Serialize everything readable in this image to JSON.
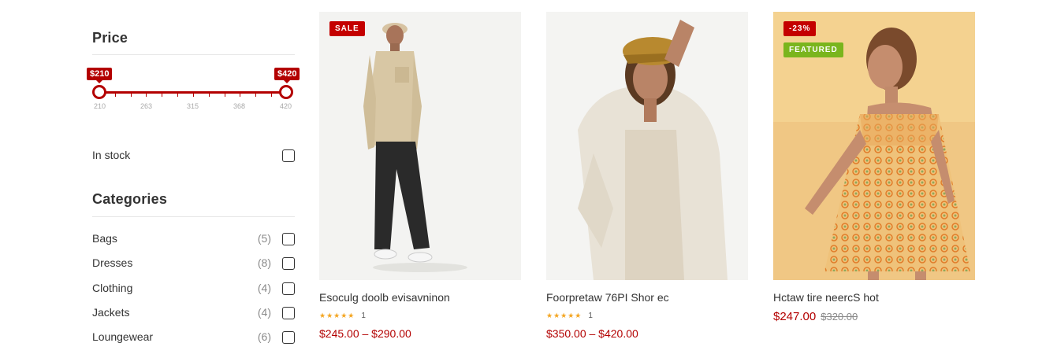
{
  "sidebar": {
    "price_filter": {
      "title": "Price",
      "min_label": "$210",
      "max_label": "$420",
      "min_value": 210,
      "max_value": 420,
      "range_min": 210,
      "range_max": 420,
      "scale": [
        "210",
        "263",
        "315",
        "368",
        "420"
      ],
      "accent": "#b30000"
    },
    "in_stock": {
      "label": "In stock",
      "checked": false
    },
    "categories": {
      "title": "Categories",
      "items": [
        {
          "label": "Bags",
          "count": "(5)"
        },
        {
          "label": "Dresses",
          "count": "(8)"
        },
        {
          "label": "Clothing",
          "count": "(4)"
        },
        {
          "label": "Jackets",
          "count": "(4)"
        },
        {
          "label": "Loungewear",
          "count": "(6)"
        }
      ]
    }
  },
  "products": [
    {
      "badges": [
        "SALE"
      ],
      "name": "Esoculg doolb evisavninon",
      "rating_count": "1",
      "stars": "★★★★★",
      "price": "$245.00 – $290.00"
    },
    {
      "badges": [],
      "name": "Foorpretaw 76PI Shor ec",
      "rating_count": "1",
      "stars": "★★★★★",
      "price": "$350.00 – $420.00"
    },
    {
      "badges": [
        "-23%",
        "FEATURED"
      ],
      "name": "Hctaw tire neercS hot",
      "price_now": "$247.00",
      "price_was": "$320.00"
    }
  ],
  "colors": {
    "brand": "#b30000",
    "featured": "#7ab51d",
    "stars": "#f4a623"
  }
}
